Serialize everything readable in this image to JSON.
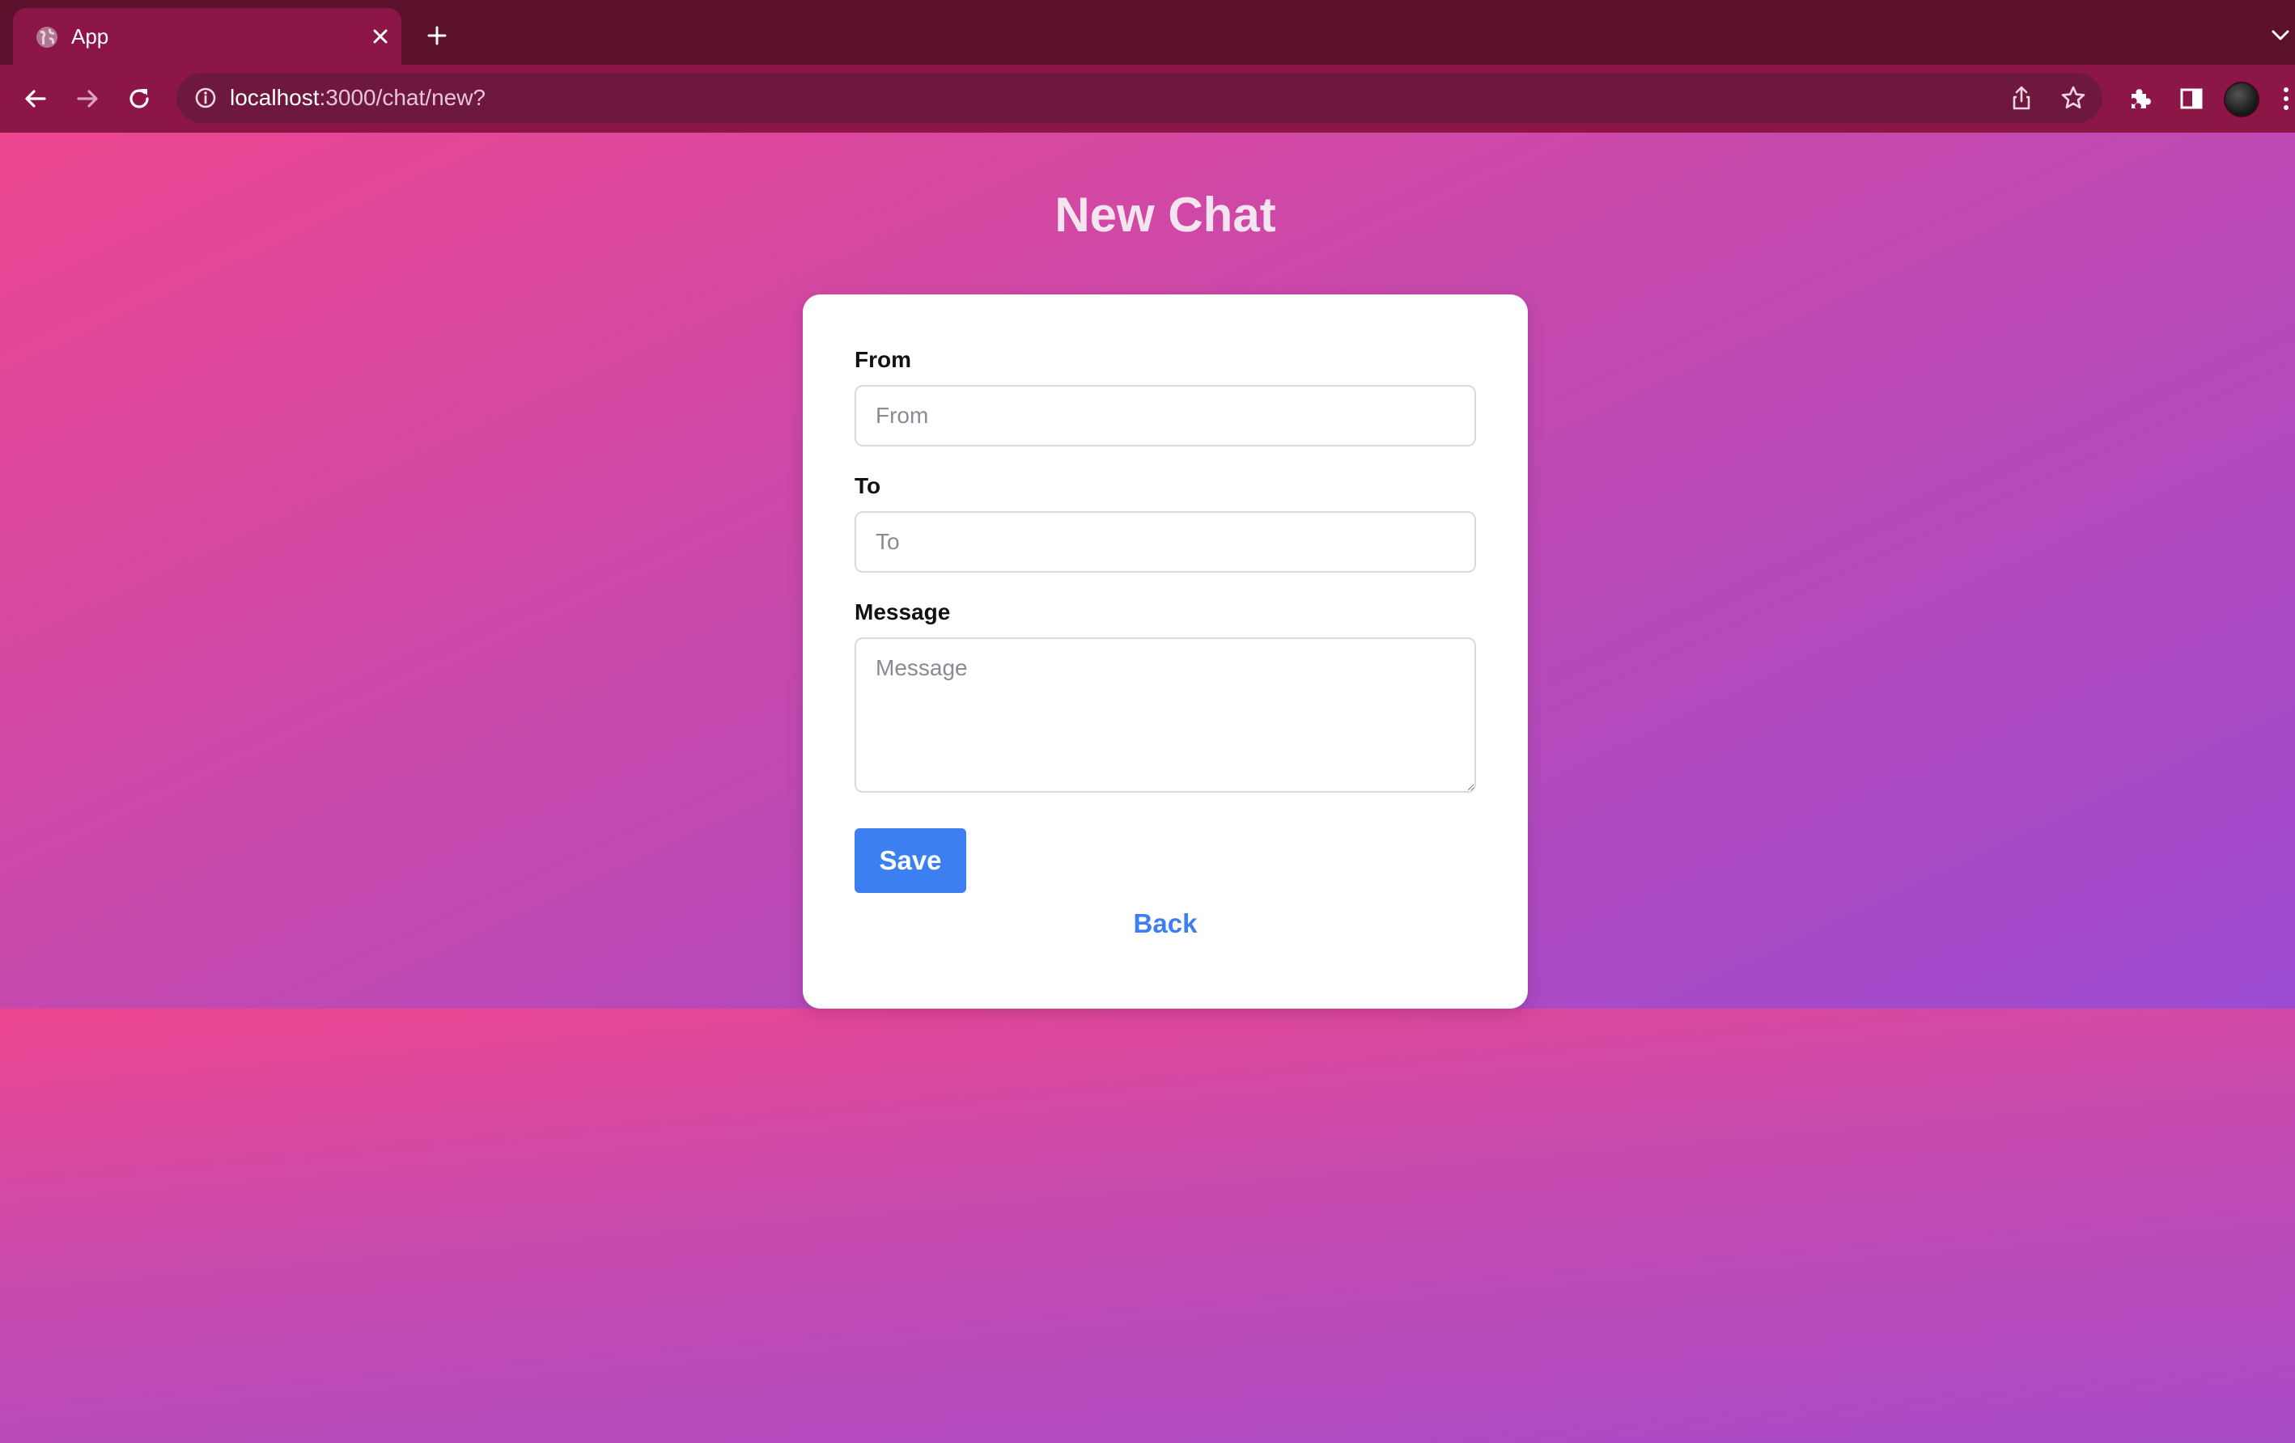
{
  "browser": {
    "tab": {
      "title": "App"
    },
    "address_bar": {
      "host": "localhost",
      "path": ":3000/chat/new?"
    }
  },
  "page": {
    "title": "New Chat",
    "form": {
      "from": {
        "label": "From",
        "placeholder": "From",
        "value": ""
      },
      "to": {
        "label": "To",
        "placeholder": "To",
        "value": ""
      },
      "message": {
        "label": "Message",
        "placeholder": "Message",
        "value": ""
      },
      "save_label": "Save",
      "back_label": "Back"
    }
  },
  "colors": {
    "tabstrip": "#5b102b",
    "toolbar": "#8c1645",
    "gradient_start": "#ec4690",
    "gradient_end": "#8b51e4",
    "primary_button": "#3b7ff0"
  }
}
